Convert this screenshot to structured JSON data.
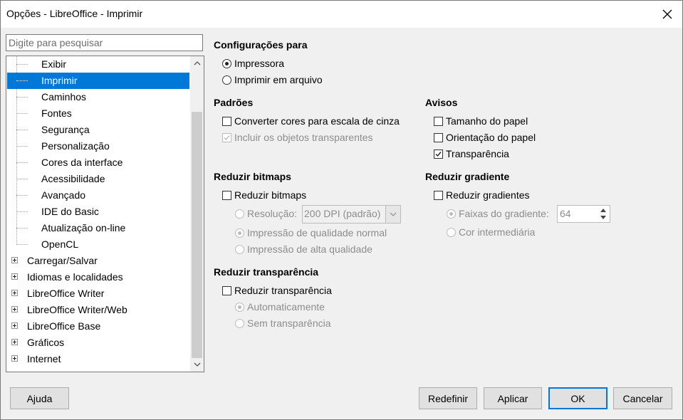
{
  "window": {
    "title": "Opções - LibreOffice - Imprimir"
  },
  "search": {
    "placeholder": "Digite para pesquisar"
  },
  "tree": {
    "children": [
      "Exibir",
      "Imprimir",
      "Caminhos",
      "Fontes",
      "Segurança",
      "Personalização",
      "Cores da interface",
      "Acessibilidade",
      "Avançado",
      "IDE do Basic",
      "Atualização on-line",
      "OpenCL"
    ],
    "selected": "Imprimir",
    "top_items": [
      "Carregar/Salvar",
      "Idiomas e localidades",
      "LibreOffice Writer",
      "LibreOffice Writer/Web",
      "LibreOffice Base",
      "Gráficos",
      "Internet"
    ]
  },
  "settings_for": {
    "heading": "Configurações para",
    "printer": {
      "label": "Impressora",
      "selected": true
    },
    "file": {
      "label": "Imprimir em arquivo",
      "selected": false
    }
  },
  "defaults": {
    "heading": "Padrões",
    "grayscale": {
      "label": "Converter cores para escala de cinza",
      "checked": false
    },
    "transparent": {
      "label": "Incluir os objetos transparentes",
      "checked": true,
      "disabled": true
    }
  },
  "warnings": {
    "heading": "Avisos",
    "paper_size": {
      "label": "Tamanho do papel",
      "checked": false
    },
    "paper_orientation": {
      "label": "Orientação do papel",
      "checked": false
    },
    "transparency": {
      "label": "Transparência",
      "checked": true
    }
  },
  "reduce_bitmaps": {
    "heading": "Reduzir bitmaps",
    "checkbox": {
      "label": "Reduzir bitmaps",
      "checked": false
    },
    "resolution": {
      "label": "Resolução:",
      "value": "200 DPI (padrão)"
    },
    "normal_quality": {
      "label": "Impressão de qualidade normal",
      "selected": true
    },
    "high_quality": {
      "label": "Impressão de alta qualidade",
      "selected": false
    }
  },
  "reduce_gradient": {
    "heading": "Reduzir gradiente",
    "checkbox": {
      "label": "Reduzir gradientes",
      "checked": false
    },
    "stripes": {
      "label": "Faixas do gradiente:",
      "value": "64",
      "selected": true
    },
    "intermediate": {
      "label": "Cor intermediária",
      "selected": false
    }
  },
  "reduce_transparency": {
    "heading": "Reduzir transparência",
    "checkbox": {
      "label": "Reduzir transparência",
      "checked": false
    },
    "auto": {
      "label": "Automaticamente",
      "selected": true
    },
    "none": {
      "label": "Sem transparência",
      "selected": false
    }
  },
  "buttons": {
    "help": "Ajuda",
    "reset": "Redefinir",
    "apply": "Aplicar",
    "ok": "OK",
    "cancel": "Cancelar"
  },
  "colors": {
    "selection": "#0078d7",
    "disabled_text": "#8d8d8d"
  }
}
